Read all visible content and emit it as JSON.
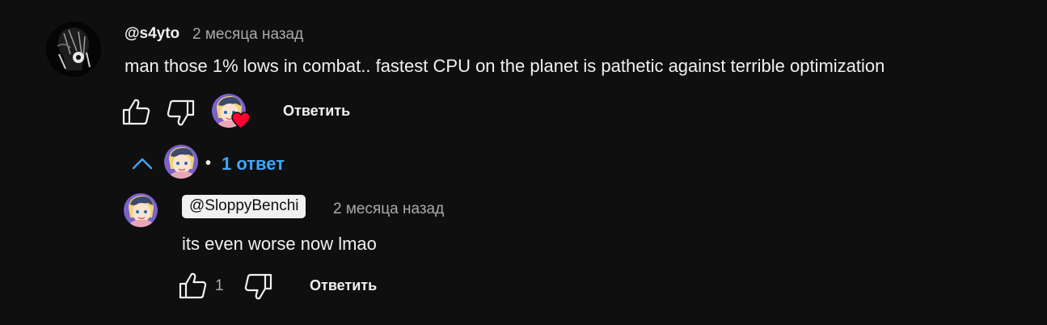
{
  "comment": {
    "author": "@s4yto",
    "time": "2 месяца назад",
    "text": "man those 1% lows in combat.. fastest CPU on the planet is pathetic against terrible optimization",
    "reply_label": "Ответить",
    "like_icon": "thumb-up-icon",
    "dislike_icon": "thumb-down-icon",
    "creator_heart_icon": "heart-icon"
  },
  "replies_toggle": {
    "separator": "•",
    "label": "1 ответ",
    "chevron_icon": "chevron-up-icon"
  },
  "reply": {
    "author": "@SloppyBenchi",
    "time": "2 месяца назад",
    "text": "its even worse now lmao",
    "like_count": "1",
    "reply_label": "Ответить"
  },
  "colors": {
    "background": "#0f0f0f",
    "text": "#f1f1f1",
    "secondary": "#aaaaaa",
    "link": "#3ea6ff",
    "heart": "#ff0033"
  }
}
